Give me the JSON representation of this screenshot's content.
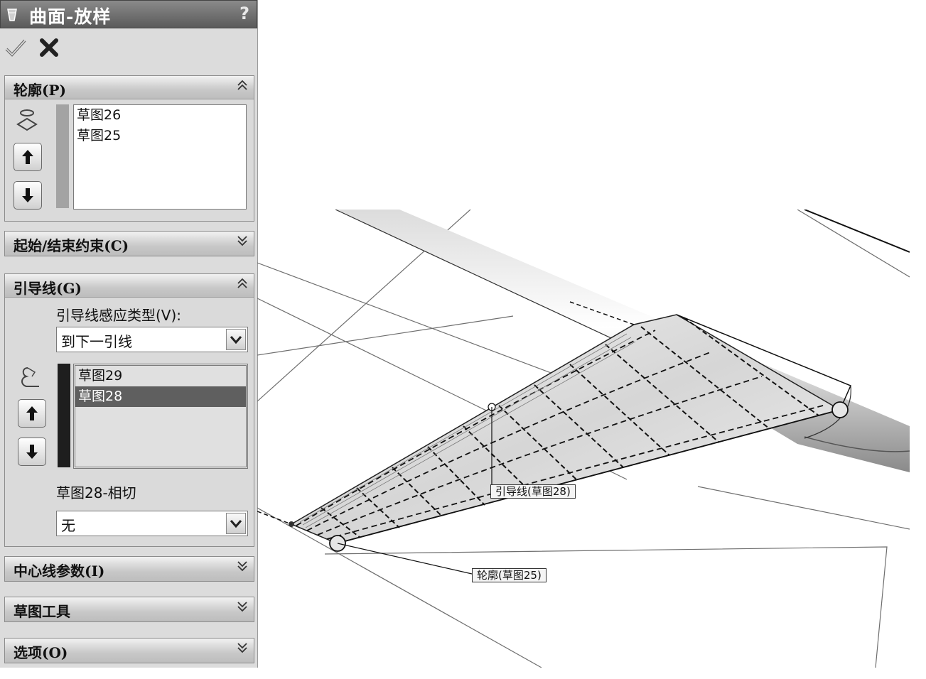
{
  "title": {
    "icon": "loft-surface-icon",
    "text": "曲面-放样",
    "help": "?"
  },
  "actions": {
    "ok_icon": "checkmark-icon",
    "cancel_icon": "close-x-icon"
  },
  "sections": {
    "profiles": {
      "title": "轮廓(P)",
      "chevron": "≈",
      "items": [
        "草图26",
        "草图25"
      ],
      "bar_color": "#a3a3a3"
    },
    "start_end": {
      "title": "起始/结束约束(C)",
      "chevron": "≋"
    },
    "guides": {
      "title": "引导线(G)",
      "chevron": "≈",
      "influence_label": "引导线感应类型(V):",
      "influence_value": "到下一引线",
      "items": [
        "草图29",
        "草图28"
      ],
      "selected_index": 1,
      "bar_color": "#1e1e1e",
      "tangency_label": "草图28-相切",
      "tangency_value": "无"
    },
    "centerline": {
      "title": "中心线参数(I)",
      "chevron": "≋"
    },
    "sketch_tools": {
      "title": "草图工具",
      "chevron": "≋"
    },
    "options": {
      "title": "选项(O)",
      "chevron": "≋"
    }
  },
  "viewport": {
    "callout_guide": "引导线(草图28)",
    "callout_profile": "轮廓(草图25)"
  }
}
